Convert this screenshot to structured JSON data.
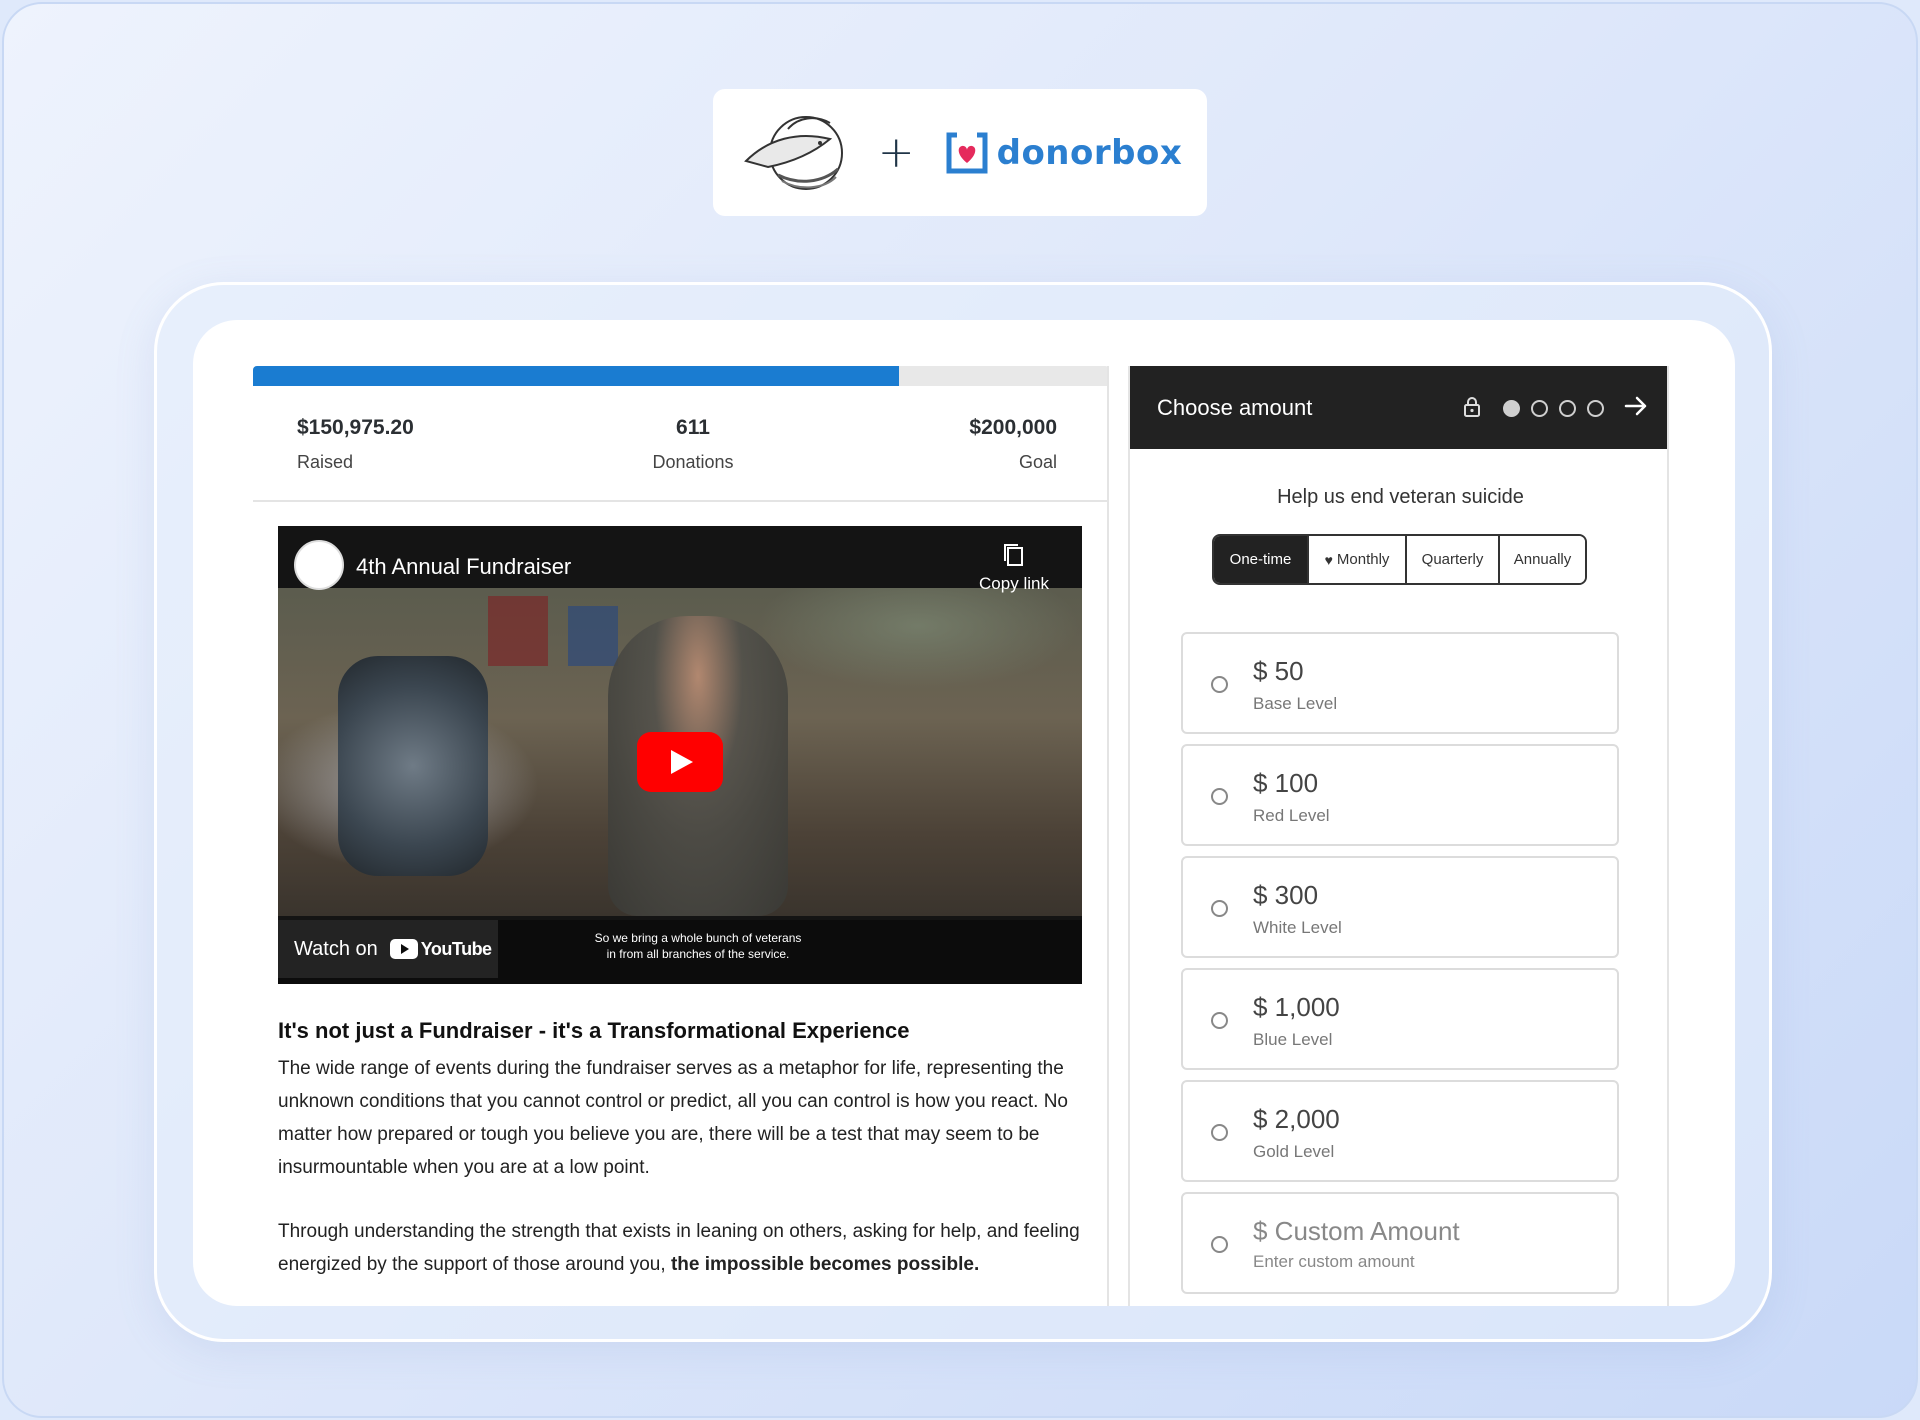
{
  "logos": {
    "plus": "+",
    "donorbox_word": "donorbox",
    "donorbox_color": "#2b7fd0"
  },
  "campaign": {
    "progress": 0.755,
    "raised_value": "$150,975.20",
    "raised_label": "Raised",
    "donations_value": "611",
    "donations_label": "Donations",
    "goal_value": "$200,000",
    "goal_label": "Goal",
    "accent_color": "#1a7cd1"
  },
  "video": {
    "title": "4th Annual Fundraiser",
    "copy_link": "Copy link",
    "watch_on": "Watch on",
    "youtube_word": "YouTube",
    "subtitle_line1": "So we bring a whole bunch of veterans",
    "subtitle_line2": "in from all branches of the service."
  },
  "article": {
    "heading": "It's not just a Fundraiser - it's a Transformational Experience",
    "paragraph1": "The wide range of events during the fundraiser serves as a metaphor for life, representing the unknown conditions that you cannot control or predict, all you can control is how you react. No matter how prepared or tough you believe you are, there will be a test that may seem to be insurmountable when you are at a low point.",
    "paragraph2_start": "Through understanding the strength that exists in leaning on others, asking for help, and feeling energized by the support of those around you, ",
    "paragraph2_bold": "the impossible becomes possible."
  },
  "donate": {
    "header_title": "Choose amount",
    "step_count": 4,
    "current_step": 1,
    "help_text": "Help us end veteran suicide",
    "frequencies": [
      {
        "label": "One-time",
        "active": true
      },
      {
        "label": "Monthly",
        "active": false
      },
      {
        "label": "Quarterly",
        "active": false
      },
      {
        "label": "Annually",
        "active": false
      }
    ],
    "amounts": [
      {
        "value": "$ 50",
        "label": "Base Level"
      },
      {
        "value": "$ 100",
        "label": "Red Level"
      },
      {
        "value": "$ 300",
        "label": "White Level"
      },
      {
        "value": "$ 1,000",
        "label": "Blue Level"
      },
      {
        "value": "$ 2,000",
        "label": "Gold Level"
      }
    ],
    "custom": {
      "value": "$ Custom Amount",
      "label": "Enter custom amount"
    }
  }
}
